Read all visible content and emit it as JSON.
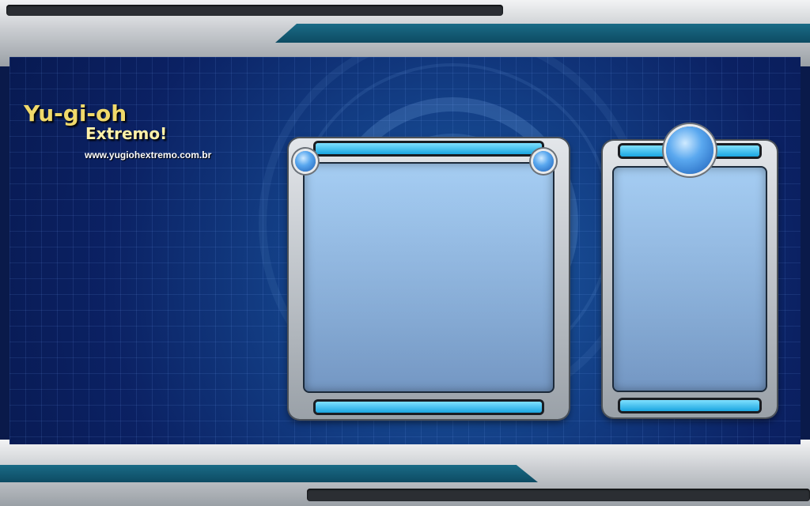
{
  "logo": {
    "title": "Yu-gi-oh",
    "subtitle": "Extremo!",
    "url": "www.yugiohextremo.com.br"
  },
  "colors": {
    "background_blue": "#0b2163",
    "frame_metal": "#c9ccd0",
    "accent_cyan": "#1aa6e0",
    "logo_gold": "#f0d96a"
  },
  "icons": {
    "card_knob": "blue-dial-icon"
  }
}
